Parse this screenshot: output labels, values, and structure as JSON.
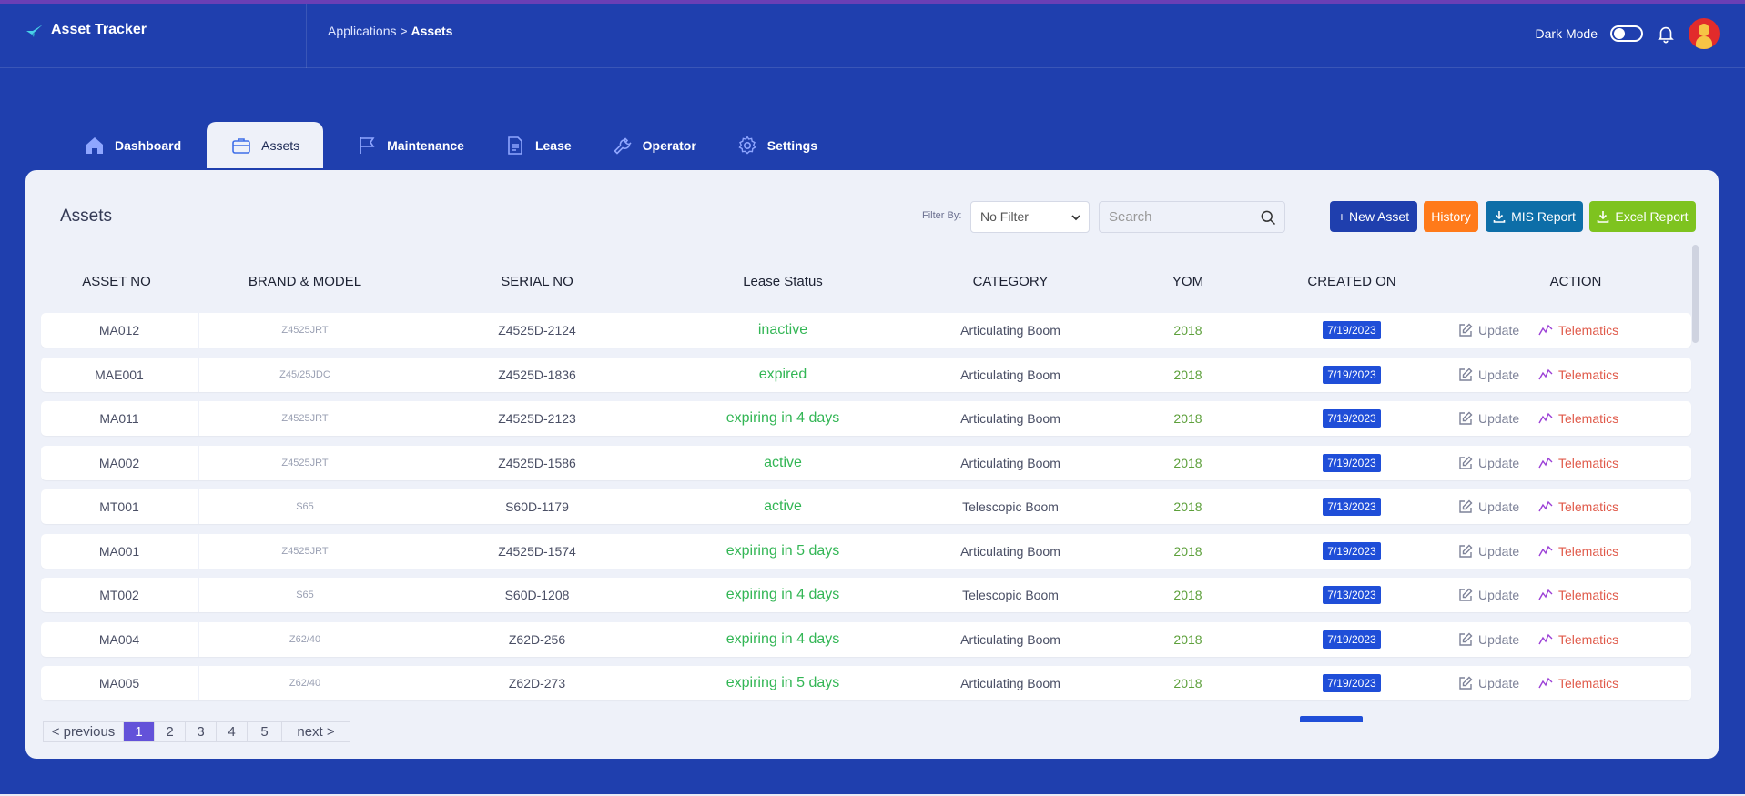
{
  "app": {
    "title": "Asset Tracker"
  },
  "breadcrumb": {
    "parent": "Applications",
    "separator": ">",
    "current": "Assets"
  },
  "header": {
    "dark_mode_label": "Dark Mode"
  },
  "tabs": [
    {
      "label": "Dashboard",
      "icon": "home-icon"
    },
    {
      "label": "Assets",
      "icon": "briefcase-icon"
    },
    {
      "label": "Maintenance",
      "icon": "flag-icon"
    },
    {
      "label": "Lease",
      "icon": "document-icon"
    },
    {
      "label": "Operator",
      "icon": "wrench-icon"
    },
    {
      "label": "Settings",
      "icon": "gear-icon"
    }
  ],
  "page": {
    "title": "Assets",
    "filter_label": "Filter By:",
    "filter_value": "No Filter",
    "search_placeholder": "Search",
    "buttons": {
      "new_asset": "+ New Asset",
      "history": "History",
      "mis_report": "MIS Report",
      "excel_report": "Excel Report"
    }
  },
  "table": {
    "columns": [
      "ASSET NO",
      "BRAND & MODEL",
      "SERIAL NO",
      "Lease Status",
      "CATEGORY",
      "YOM",
      "CREATED ON",
      "ACTION"
    ],
    "action_labels": {
      "update": "Update",
      "telematics": "Telematics"
    },
    "rows": [
      {
        "asset": "MA012",
        "brand": "Z4525JRT",
        "serial": "Z4525D-2124",
        "lease": "inactive",
        "category": "Articulating Boom",
        "yom": "2018",
        "created": "7/19/2023"
      },
      {
        "asset": "MAE001",
        "brand": "Z45/25JDC",
        "serial": "Z4525D-1836",
        "lease": "expired",
        "category": "Articulating Boom",
        "yom": "2018",
        "created": "7/19/2023"
      },
      {
        "asset": "MA011",
        "brand": "Z4525JRT",
        "serial": "Z4525D-2123",
        "lease": "expiring in 4 days",
        "category": "Articulating Boom",
        "yom": "2018",
        "created": "7/19/2023"
      },
      {
        "asset": "MA002",
        "brand": "Z4525JRT",
        "serial": "Z4525D-1586",
        "lease": "active",
        "category": "Articulating Boom",
        "yom": "2018",
        "created": "7/19/2023"
      },
      {
        "asset": "MT001",
        "brand": "S65",
        "serial": "S60D-1179",
        "lease": "active",
        "category": "Telescopic Boom",
        "yom": "2018",
        "created": "7/13/2023"
      },
      {
        "asset": "MA001",
        "brand": "Z4525JRT",
        "serial": "Z4525D-1574",
        "lease": "expiring in 5 days",
        "category": "Articulating Boom",
        "yom": "2018",
        "created": "7/19/2023"
      },
      {
        "asset": "MT002",
        "brand": "S65",
        "serial": "S60D-1208",
        "lease": "expiring in 4 days",
        "category": "Telescopic Boom",
        "yom": "2018",
        "created": "7/13/2023"
      },
      {
        "asset": "MA004",
        "brand": "Z62/40",
        "serial": "Z62D-256",
        "lease": "expiring in 4 days",
        "category": "Articulating Boom",
        "yom": "2018",
        "created": "7/19/2023"
      },
      {
        "asset": "MA005",
        "brand": "Z62/40",
        "serial": "Z62D-273",
        "lease": "expiring in 5 days",
        "category": "Articulating Boom",
        "yom": "2018",
        "created": "7/19/2023"
      }
    ]
  },
  "pagination": {
    "previous": "< previous",
    "pages": [
      "1",
      "2",
      "3",
      "4",
      "5"
    ],
    "current": "1",
    "next": "next >"
  },
  "colors": {
    "primary": "#1f3fae",
    "accent_purple": "#6352d9",
    "status_green": "#33b655",
    "history_orange": "#ff7a1a",
    "mis_blue": "#0d6ea8",
    "excel_green": "#7ec31f",
    "telematics_red": "#e05a4a"
  }
}
